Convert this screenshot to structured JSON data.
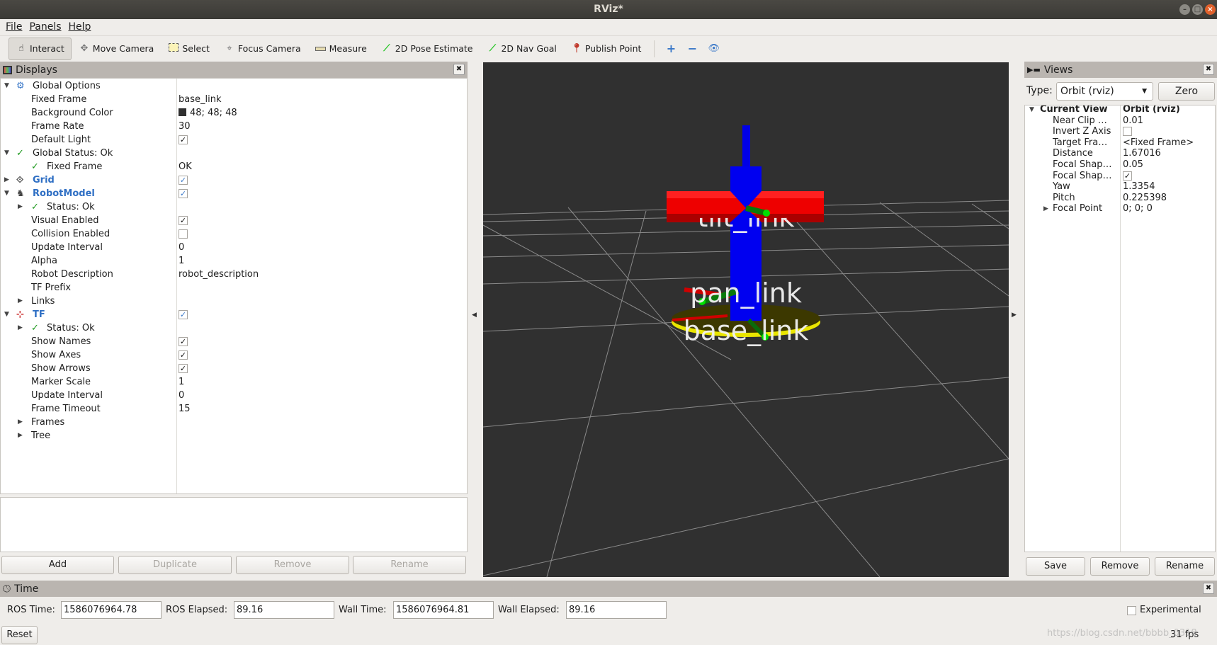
{
  "window": {
    "title": "RViz*"
  },
  "menu": [
    "File",
    "Panels",
    "Help"
  ],
  "toolbar": {
    "tools": [
      {
        "label": "Interact",
        "icon": "hand-pointer-icon"
      },
      {
        "label": "Move Camera",
        "icon": "move-camera-icon"
      },
      {
        "label": "Select",
        "icon": "select-box-icon"
      },
      {
        "label": "Focus Camera",
        "icon": "crosshair-icon"
      },
      {
        "label": "Measure",
        "icon": "ruler-icon"
      },
      {
        "label": "2D Pose Estimate",
        "icon": "green-arrow-icon"
      },
      {
        "label": "2D Nav Goal",
        "icon": "green-arrow-icon"
      },
      {
        "label": "Publish Point",
        "icon": "map-pin-icon"
      }
    ],
    "active": "Interact"
  },
  "displays": {
    "title": "Displays",
    "rows": [
      {
        "label": "Global Options",
        "value": "",
        "level": 0,
        "expander": "open",
        "icon": "gear"
      },
      {
        "label": "Fixed Frame",
        "value": "base_link",
        "level": 1
      },
      {
        "label": "Background Color",
        "value": "48; 48; 48",
        "level": 1,
        "swatch": "#303030"
      },
      {
        "label": "Frame Rate",
        "value": "30",
        "level": 1
      },
      {
        "label": "Default Light",
        "value": "",
        "level": 1,
        "check": true
      },
      {
        "label": "Global Status: Ok",
        "value": "",
        "level": 0,
        "expander": "open",
        "icon": "ok"
      },
      {
        "label": "Fixed Frame",
        "value": "OK",
        "level": 2,
        "icon": "ok"
      },
      {
        "label": "Grid",
        "value": "",
        "level": 0,
        "expander": "closed",
        "icon": "grid",
        "bold": true,
        "check": true,
        "blue": true
      },
      {
        "label": "RobotModel",
        "value": "",
        "level": 0,
        "expander": "open",
        "icon": "robot",
        "bold": true,
        "check": true,
        "blue": true
      },
      {
        "label": "Status: Ok",
        "value": "",
        "level": 2,
        "expander": "closed",
        "icon": "ok"
      },
      {
        "label": "Visual Enabled",
        "value": "",
        "level": 1,
        "check": true
      },
      {
        "label": "Collision Enabled",
        "value": "",
        "level": 1,
        "check": false
      },
      {
        "label": "Update Interval",
        "value": "0",
        "level": 1
      },
      {
        "label": "Alpha",
        "value": "1",
        "level": 1
      },
      {
        "label": "Robot Description",
        "value": "robot_description",
        "level": 1
      },
      {
        "label": "TF Prefix",
        "value": "",
        "level": 1
      },
      {
        "label": "Links",
        "value": "",
        "level": 1,
        "expander": "closed"
      },
      {
        "label": "TF",
        "value": "",
        "level": 0,
        "expander": "open",
        "icon": "axes",
        "bold": true,
        "check": true,
        "blue": true
      },
      {
        "label": "Status: Ok",
        "value": "",
        "level": 2,
        "expander": "closed",
        "icon": "ok"
      },
      {
        "label": "Show Names",
        "value": "",
        "level": 1,
        "check": true
      },
      {
        "label": "Show Axes",
        "value": "",
        "level": 1,
        "check": true
      },
      {
        "label": "Show Arrows",
        "value": "",
        "level": 1,
        "check": true
      },
      {
        "label": "Marker Scale",
        "value": "1",
        "level": 1
      },
      {
        "label": "Update Interval",
        "value": "0",
        "level": 1
      },
      {
        "label": "Frame Timeout",
        "value": "15",
        "level": 1
      },
      {
        "label": "Frames",
        "value": "",
        "level": 1,
        "expander": "closed"
      },
      {
        "label": "Tree",
        "value": "",
        "level": 1,
        "expander": "closed"
      }
    ],
    "buttons": {
      "add": "Add",
      "duplicate": "Duplicate",
      "remove": "Remove",
      "rename": "Rename"
    }
  },
  "viewport": {
    "background": "#303030",
    "labels": [
      "tilt_link",
      "pan_link",
      "base_link"
    ]
  },
  "views": {
    "title": "Views",
    "type_label": "Type:",
    "type_value": "Orbit (rviz)",
    "zero": "Zero",
    "rows": [
      {
        "label": "Current View",
        "value": "Orbit (rviz)",
        "header": true
      },
      {
        "label": "Near Clip …",
        "value": "0.01"
      },
      {
        "label": "Invert Z Axis",
        "value": "",
        "check": false
      },
      {
        "label": "Target Fra…",
        "value": "<Fixed Frame>"
      },
      {
        "label": "Distance",
        "value": "1.67016"
      },
      {
        "label": "Focal Shap…",
        "value": "0.05"
      },
      {
        "label": "Focal Shap…",
        "value": "",
        "check": true
      },
      {
        "label": "Yaw",
        "value": "1.3354"
      },
      {
        "label": "Pitch",
        "value": "0.225398"
      },
      {
        "label": "Focal Point",
        "value": "0; 0; 0",
        "expander": true
      }
    ],
    "buttons": {
      "save": "Save",
      "remove": "Remove",
      "rename": "Rename"
    }
  },
  "time": {
    "title": "Time",
    "ros_time_label": "ROS Time:",
    "ros_time": "1586076964.78",
    "ros_elapsed_label": "ROS Elapsed:",
    "ros_elapsed": "89.16",
    "wall_time_label": "Wall Time:",
    "wall_time": "1586076964.81",
    "wall_elapsed_label": "Wall Elapsed:",
    "wall_elapsed": "89.16",
    "experimental": "Experimental",
    "reset": "Reset",
    "fps": "31 fps"
  },
  "watermark": "https://blog.csdn.net/bbbb_0318"
}
